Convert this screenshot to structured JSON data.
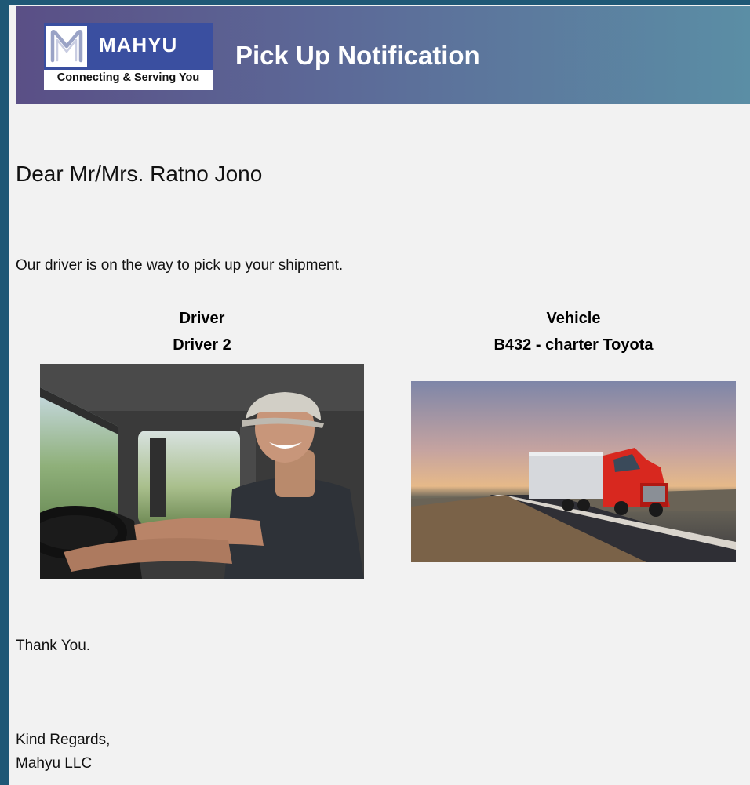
{
  "header": {
    "logo_name": "MAHYU",
    "logo_tagline": "Connecting & Serving You",
    "title": "Pick Up Notification"
  },
  "body": {
    "greeting": "Dear Mr/Mrs. Ratno Jono",
    "intro": "Our driver is on the way to pick up your shipment.",
    "driver": {
      "heading": "Driver",
      "name": "Driver 2",
      "photo": "driver-photo"
    },
    "vehicle": {
      "heading": "Vehicle",
      "name": "B432 - charter Toyota",
      "photo": "truck-photo"
    },
    "thanks": "Thank You.",
    "closing": "Kind Regards,",
    "signature": "Mahyu LLC"
  },
  "colors": {
    "outer_background": "#1f5876",
    "page_background": "#f2f2f2",
    "header_gradient_start": "#5a4f86",
    "header_gradient_end": "#5b8ea5",
    "logo_blue": "#3a4fa0"
  }
}
